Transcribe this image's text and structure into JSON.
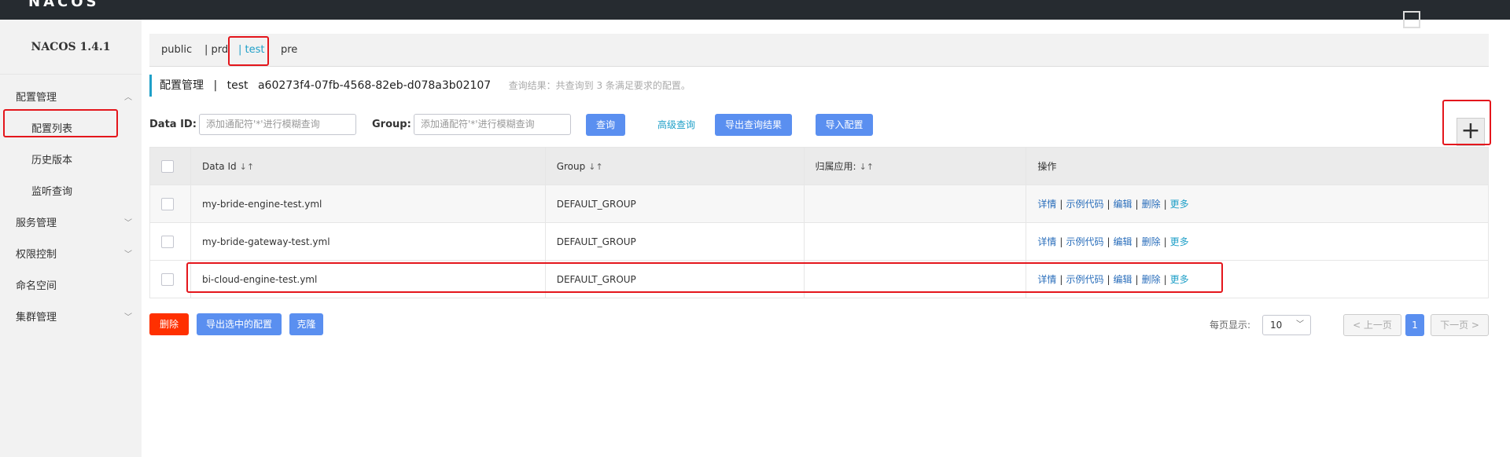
{
  "app": {
    "logo": "NACOS"
  },
  "sidebar": {
    "brand": "NACOS 1.4.1",
    "groups": [
      {
        "label": "配置管理",
        "items": [
          "配置列表",
          "历史版本",
          "监听查询"
        ]
      },
      {
        "label": "服务管理"
      },
      {
        "label": "权限控制"
      },
      {
        "label": "命名空间"
      },
      {
        "label": "集群管理"
      }
    ]
  },
  "namespaces": [
    "public",
    "| prd",
    "| test",
    "pre"
  ],
  "header": {
    "title": "配置管理",
    "sep": "|",
    "namespace": "test",
    "namespace_id": "a60273f4-07fb-4568-82eb-d078a3b02107",
    "summary": "查询结果：共查询到 3 条满足要求的配置。"
  },
  "filters": {
    "data_id_label": "Data ID:",
    "data_id_placeholder": "添加通配符'*'进行模糊查询",
    "group_label": "Group:",
    "group_placeholder": "添加通配符'*'进行模糊查询",
    "query": "查询",
    "advanced": "高级查询",
    "export_results": "导出查询结果",
    "import": "导入配置",
    "add": "+"
  },
  "table": {
    "columns": [
      "Data Id",
      "Group",
      "归属应用:",
      "操作"
    ],
    "rows": [
      {
        "data_id": "my-bride-engine-test.yml",
        "group": "DEFAULT_GROUP",
        "app": ""
      },
      {
        "data_id": "my-bride-gateway-test.yml",
        "group": "DEFAULT_GROUP",
        "app": ""
      },
      {
        "data_id": "bi-cloud-engine-test.yml",
        "group": "DEFAULT_GROUP",
        "app": ""
      }
    ],
    "ops": [
      "详情",
      "示例代码",
      "编辑",
      "删除",
      "更多"
    ],
    "ops_sep": "|"
  },
  "actions": {
    "delete": "删除",
    "export_selected": "导出选中的配置",
    "clone": "克隆"
  },
  "pager": {
    "label": "每页显示:",
    "size": "10",
    "prev": "< 上一页",
    "page": "1",
    "next": "下一页 >"
  },
  "colors": {
    "accent": "#20a0c8",
    "primary": "#5a8ff0",
    "danger": "#ff3000",
    "highlight": "#e4161c"
  }
}
